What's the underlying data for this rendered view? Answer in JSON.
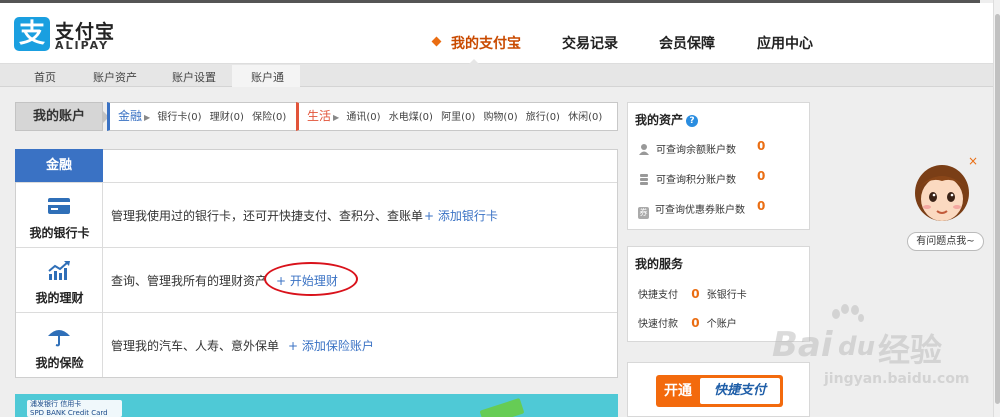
{
  "brand": {
    "name_cn": "支付宝",
    "name_en": "ALIPAY",
    "logo_glyph": "支",
    "color": "#1a9fe0"
  },
  "top_nav": [
    {
      "label": "我的支付宝",
      "active": true
    },
    {
      "label": "交易记录",
      "active": false
    },
    {
      "label": "会员保障",
      "active": false
    },
    {
      "label": "应用中心",
      "active": false
    }
  ],
  "sub_nav": [
    {
      "label": "首页"
    },
    {
      "label": "账户资产"
    },
    {
      "label": "账户设置"
    },
    {
      "label": "账户通",
      "active": true
    }
  ],
  "account_bar": {
    "label": "我的账户",
    "finance": {
      "title": "金融",
      "items": [
        "银行卡(0)",
        "理财(0)",
        "保险(0)"
      ]
    },
    "life": {
      "title": "生活",
      "items": [
        "通讯(0)",
        "水电煤(0)",
        "阿里(0)",
        "购物(0)",
        "旅行(0)",
        "休闲(0)"
      ]
    }
  },
  "finance_panel": {
    "tab": "金融",
    "rows": [
      {
        "icon": "bank-card-icon",
        "name": "我的银行卡",
        "desc": "管理我使用过的银行卡，还可开快捷支付、查积分、查账单",
        "link": "+ 添加银行卡"
      },
      {
        "icon": "chart-icon",
        "name": "我的理财",
        "desc": "查询、管理我所有的理财资产",
        "link": "+ 开始理财"
      },
      {
        "icon": "umbrella-icon",
        "name": "我的保险",
        "desc": "管理我的汽车、人寿、意外保单",
        "link": "+ 添加保险账户"
      }
    ]
  },
  "banner": {
    "logo_text_1": "浦发银行 信用卡",
    "logo_text_2": "SPD BANK Credit Card"
  },
  "assets": {
    "title": "我的资产",
    "help_glyph": "?",
    "rows": [
      {
        "icon": "person-icon",
        "label": "可查询余额账户数",
        "count": "0"
      },
      {
        "icon": "coins-icon",
        "label": "可查询积分账户数",
        "count": "0"
      },
      {
        "icon": "voucher-icon",
        "icon_glyph": "券",
        "label": "可查询优惠券账户数",
        "count": "0"
      }
    ]
  },
  "services": {
    "title": "我的服务",
    "rows": [
      {
        "label": "快捷支付",
        "count": "0",
        "unit": "张银行卡"
      },
      {
        "label": "快速付款",
        "count": "0",
        "unit": "个账户"
      }
    ]
  },
  "open_button": {
    "left": "开通",
    "right": "快捷支付"
  },
  "helper": {
    "bubble": "有问题点我~",
    "close": "×"
  },
  "watermark": {
    "brand": "Bai",
    "paw": "du",
    "cn": "经验",
    "url": "jingyan.baidu.com"
  },
  "colors": {
    "accent_orange": "#ea6d12",
    "finance_blue": "#3a72c4",
    "life_red": "#e2543a",
    "annotation_red": "#d9121b"
  }
}
